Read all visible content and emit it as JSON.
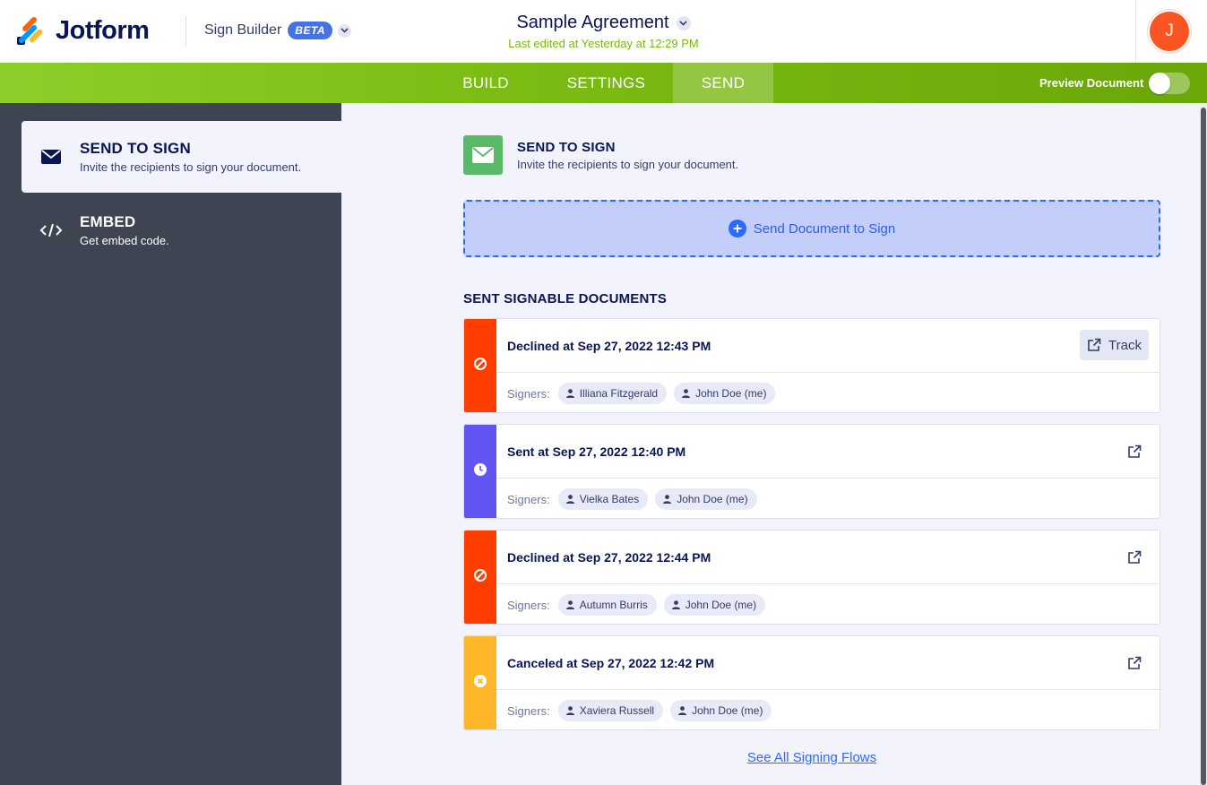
{
  "header": {
    "logo_text": "Jotform",
    "product": "Sign Builder",
    "beta_badge": "BETA",
    "document_title": "Sample Agreement",
    "last_edited": "Last edited at Yesterday at 12:29 PM",
    "avatar_initial": "J",
    "avatar_color": "#fa5522"
  },
  "nav": {
    "tabs": [
      {
        "label": "BUILD",
        "active": false
      },
      {
        "label": "SETTINGS",
        "active": false
      },
      {
        "label": "SEND",
        "active": true
      }
    ],
    "preview_label": "Preview Document",
    "preview_enabled": false,
    "bar_color": "#7cbd14"
  },
  "sidebar": {
    "items": [
      {
        "title": "SEND TO SIGN",
        "subtitle": "Invite the recipients to sign your document.",
        "icon": "envelope-icon",
        "active": true
      },
      {
        "title": "EMBED",
        "subtitle": "Get embed code.",
        "icon": "code-icon",
        "active": false
      }
    ]
  },
  "main": {
    "section_title": "SEND TO SIGN",
    "section_subtitle": "Invite the recipients to sign your document.",
    "send_button": "Send Document to Sign",
    "list_heading": "SENT SIGNABLE DOCUMENTS",
    "signers_label": "Signers:",
    "track_label": "Track",
    "documents": [
      {
        "status": "Declined at Sep 27, 2022 12:43 PM",
        "state": "declined",
        "color": "#ff3d00",
        "signers": [
          "Illiana Fitzgerald",
          "John Doe (me)"
        ]
      },
      {
        "status": "Sent at Sep 27, 2022 12:40 PM",
        "state": "sent",
        "color": "#6156f2",
        "signers": [
          "Vielka Bates",
          "John Doe (me)"
        ]
      },
      {
        "status": "Declined at Sep 27, 2022 12:44 PM",
        "state": "declined",
        "color": "#ff3d00",
        "signers": [
          "Autumn Burris",
          "John Doe (me)"
        ]
      },
      {
        "status": "Canceled at Sep 27, 2022 12:42 PM",
        "state": "canceled",
        "color": "#ffb629",
        "signers": [
          "Xaviera Russell",
          "John Doe (me)"
        ]
      }
    ],
    "see_all": "See All Signing Flows"
  }
}
